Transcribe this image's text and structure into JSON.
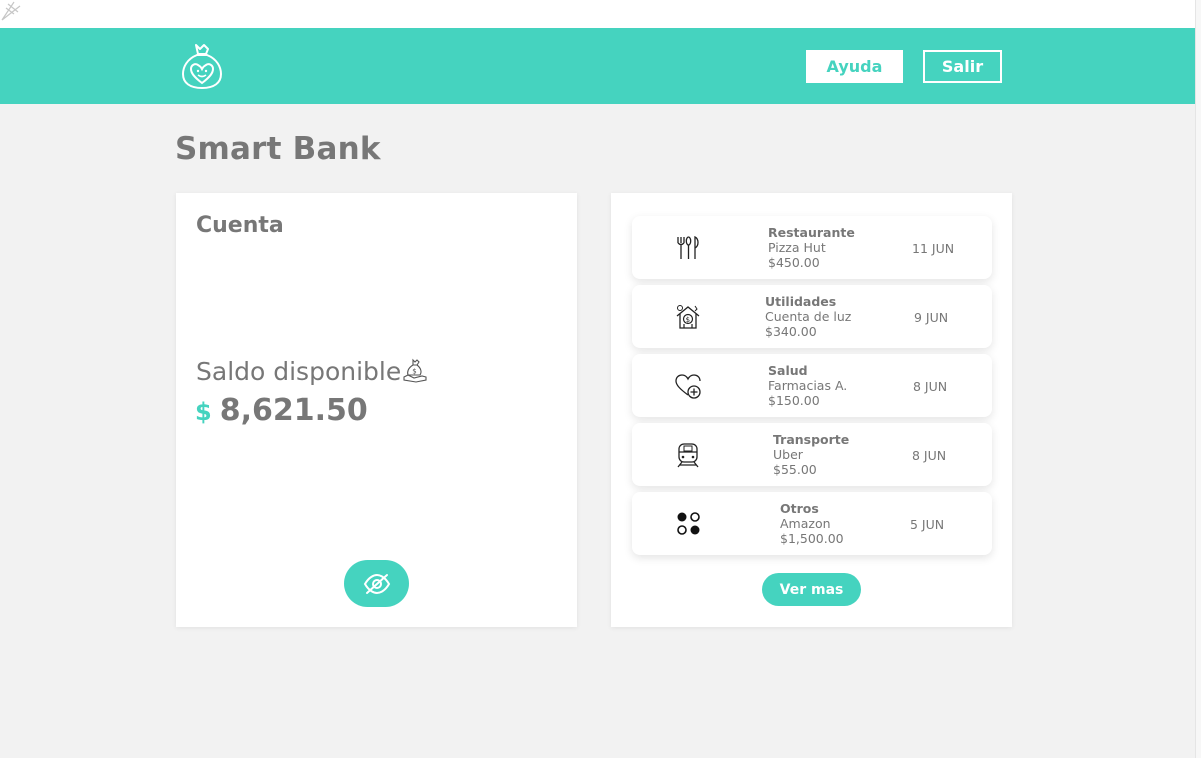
{
  "header": {
    "help_label": "Ayuda",
    "exit_label": "Salir"
  },
  "main": {
    "title": "Smart Bank"
  },
  "account": {
    "title": "Cuenta",
    "balance_label": "Saldo disponible",
    "currency": "$",
    "balance": "8,621.50"
  },
  "transactions": {
    "items": [
      {
        "category": "Restaurante",
        "description": "Pizza Hut",
        "amount": "$450.00",
        "date": "11 JUN",
        "icon": "utensils-icon"
      },
      {
        "category": "Utilidades",
        "description": "Cuenta de luz",
        "amount": "$340.00",
        "date": "9 JUN",
        "icon": "house-bill-icon"
      },
      {
        "category": "Salud",
        "description": "Farmacias A.",
        "amount": "$150.00",
        "date": "8 JUN",
        "icon": "heart-plus-icon"
      },
      {
        "category": "Transporte",
        "description": "Uber",
        "amount": "$55.00",
        "date": "8 JUN",
        "icon": "train-icon"
      },
      {
        "category": "Otros",
        "description": "Amazon",
        "amount": "$1,500.00",
        "date": "5 JUN",
        "icon": "dots-icon"
      }
    ],
    "more_label": "Ver mas"
  },
  "colors": {
    "accent": "#45d3bf",
    "background": "#f2f2f2",
    "text": "#777777",
    "card": "#ffffff"
  }
}
